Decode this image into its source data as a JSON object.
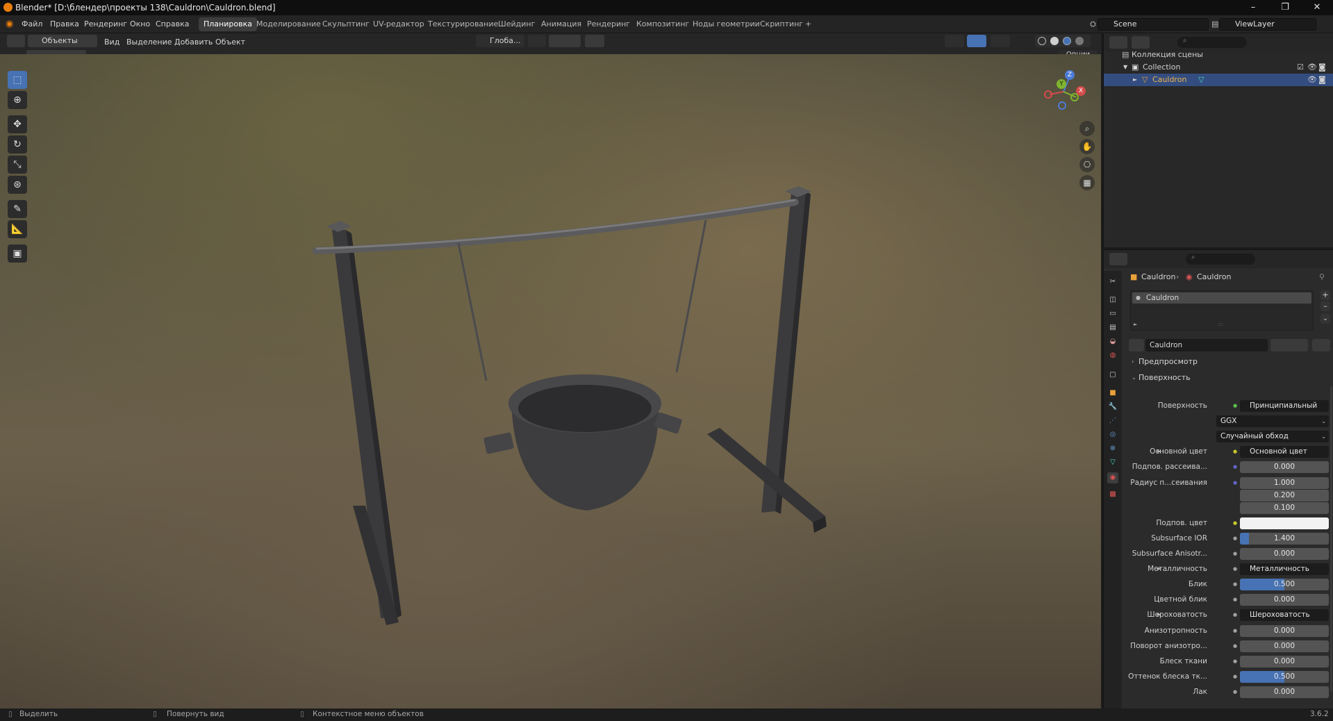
{
  "window": {
    "title": "Blender* [D:\\блендер\\проекты 138\\Cauldron\\Cauldron.blend]",
    "minimize": "–",
    "maximize": "❐",
    "close": "✕"
  },
  "menu": {
    "items": [
      "Файл",
      "Правка",
      "Рендеринг",
      "Окно",
      "Справка"
    ],
    "workspaces": [
      "Планировка",
      "Моделирование",
      "Скульптинг",
      "UV-редактор",
      "Текстурирование",
      "Шейдинг",
      "Анимация",
      "Рендеринг",
      "Композитинг",
      "Ноды геометрии",
      "Скриптинг",
      "+"
    ],
    "active_workspace": "Планировка",
    "scene": "Scene",
    "view_layer": "ViewLayer"
  },
  "viewport_header": {
    "mode": "Объекты",
    "menus": [
      "Вид",
      "Выделение",
      "Добавить",
      "Объект"
    ],
    "transform_orientation": "Глоба...",
    "options": "Опции"
  },
  "gizmo": {
    "z": "Z",
    "y": "Y",
    "x": "X"
  },
  "outliner": {
    "scene_collection": "Коллекция сцены",
    "collection": "Collection",
    "object": "Cauldron"
  },
  "properties": {
    "breadcrumb_object": "Cauldron",
    "breadcrumb_material": "Cauldron",
    "slot_name": "Cauldron",
    "material_name": "Cauldron",
    "panel_preview": "Предпросмотр",
    "panel_surface": "Поверхность",
    "rows": [
      {
        "label": "Поверхность",
        "value": "Принципиальный BSDF",
        "kind": "link",
        "dot": "#5fbf4f"
      },
      {
        "label": "",
        "value": "GGX",
        "kind": "dropdown"
      },
      {
        "label": "",
        "value": "Случайный обход",
        "kind": "dropdown"
      },
      {
        "label": "Основной цвет",
        "value": "Основной цвет",
        "kind": "link",
        "dot": "#c7c729",
        "expand": true
      },
      {
        "label": "Подпов. рассеива...",
        "value": "0.000",
        "kind": "number",
        "dot": "#6363c7"
      },
      {
        "label": "Радиус п...сеивания",
        "value": "1.000",
        "kind": "number",
        "dot": "#6363c7"
      },
      {
        "label": "",
        "value": "0.200",
        "kind": "number"
      },
      {
        "label": "",
        "value": "0.100",
        "kind": "number"
      },
      {
        "label": "Подпов. цвет",
        "value": "",
        "kind": "color",
        "dot": "#c7c729"
      },
      {
        "label": "Subsurface IOR",
        "value": "1.400",
        "kind": "number",
        "dot": "#a1a1a1",
        "fill": 0.1
      },
      {
        "label": "Subsurface Anisotr...",
        "value": "0.000",
        "kind": "number",
        "dot": "#a1a1a1"
      },
      {
        "label": "Металличность",
        "value": "Металличность",
        "kind": "link",
        "dot": "#a1a1a1",
        "expand": true
      },
      {
        "label": "Блик",
        "value": "0.500",
        "kind": "number",
        "dot": "#a1a1a1",
        "fill": 0.5
      },
      {
        "label": "Цветной блик",
        "value": "0.000",
        "kind": "number",
        "dot": "#a1a1a1"
      },
      {
        "label": "Шероховатость",
        "value": "Шероховатость",
        "kind": "link",
        "dot": "#a1a1a1",
        "expand": true
      },
      {
        "label": "Анизотропность",
        "value": "0.000",
        "kind": "number",
        "dot": "#a1a1a1"
      },
      {
        "label": "Поворот анизотро...",
        "value": "0.000",
        "kind": "number",
        "dot": "#a1a1a1"
      },
      {
        "label": "Блеск ткани",
        "value": "0.000",
        "kind": "number",
        "dot": "#a1a1a1"
      },
      {
        "label": "Оттенок блеска тк...",
        "value": "0.500",
        "kind": "number",
        "dot": "#a1a1a1",
        "fill": 0.5
      },
      {
        "label": "Лак",
        "value": "0.000",
        "kind": "number",
        "dot": "#a1a1a1"
      }
    ]
  },
  "status": {
    "select": "Выделить",
    "rotate": "Повернуть вид",
    "context": "Контекстное меню объектов",
    "version": "3.6.2"
  }
}
